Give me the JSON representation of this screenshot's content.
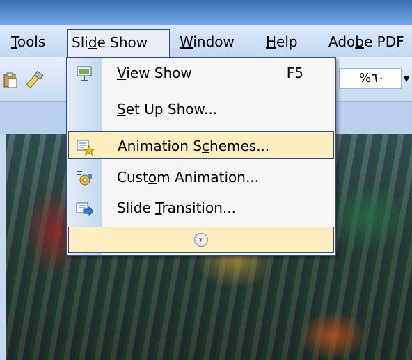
{
  "menubar": {
    "items": [
      {
        "label": "Tools"
      },
      {
        "label": "Slide Show"
      },
      {
        "label": "Window"
      },
      {
        "label": "Help"
      },
      {
        "label": "Adobe PDF"
      }
    ]
  },
  "toolbar": {
    "zoom_value": "%٦٠"
  },
  "slide_show_menu": {
    "items": [
      {
        "label": "View Show",
        "shortcut": "F5",
        "icon": "projector-icon"
      },
      {
        "label": "Set Up Show...",
        "shortcut": "",
        "icon": ""
      },
      {
        "label": "Animation Schemes...",
        "shortcut": "",
        "icon": "animation-schemes-icon",
        "highlighted": true
      },
      {
        "label": "Custom Animation...",
        "shortcut": "",
        "icon": "custom-animation-icon"
      },
      {
        "label": "Slide Transition...",
        "shortcut": "",
        "icon": "slide-transition-icon"
      }
    ],
    "expand_icon": "double-chevron-down-icon"
  },
  "colors": {
    "menu_highlight": "#ffeec2",
    "menu_border": "#334f7a",
    "menubar_bg": "#c4d8f2"
  }
}
